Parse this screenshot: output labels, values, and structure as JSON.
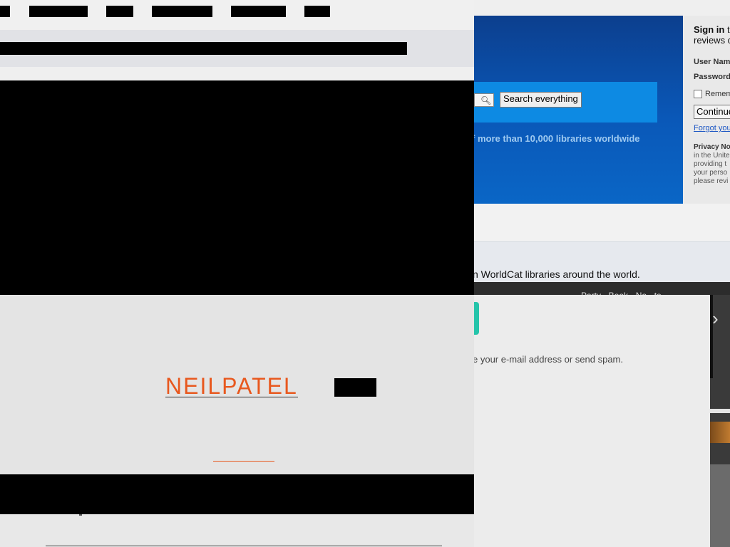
{
  "worldcat": {
    "search_button_label": "Search everything",
    "search_icon": "magnifier-icon",
    "hero_text": "f more than 10,000 libraries worldwide",
    "signin": {
      "title_bold": "Sign in",
      "title_rest": " t",
      "title_line2": "reviews c",
      "username_label": "User Nam",
      "password_label": "Password",
      "remember_label": "Remem",
      "continue_label": "Continue",
      "forgot_label": "Forgot you",
      "privacy_title": "Privacy No",
      "privacy_lines": [
        "in the Unite",
        "providing t",
        "your perso",
        "please revi"
      ]
    },
    "strip_text": "n WorldCat libraries around the world.",
    "dark_bar_text": "Party · Book · No · to",
    "panel_text": "e your e-mail address or send spam.",
    "accent": "#25c4aa"
  },
  "neilpatel": {
    "logo_text": "NEILPATEL",
    "brand_color": "#e8581e"
  }
}
